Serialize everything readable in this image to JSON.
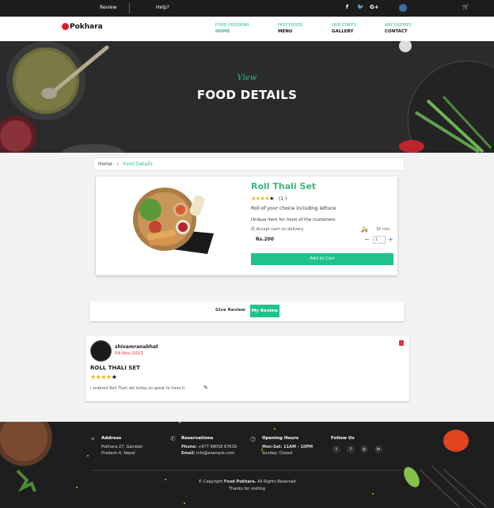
{
  "topbar": {
    "review": "Review",
    "help": "Help?",
    "icons": [
      "facebook-icon",
      "twitter-icon",
      "google-plus-icon",
      "user-icon",
      "cart-icon"
    ],
    "gplus": "G+"
  },
  "brand": {
    "name": "Pokhara"
  },
  "nav": [
    {
      "sub": "FOOD ORDERING",
      "main": "HOME"
    },
    {
      "sub": "FAST FOODS",
      "main": "MENU"
    },
    {
      "sub": "OUR STAFFS",
      "main": "GALLERY"
    },
    {
      "sub": "ANY QUERIES",
      "main": "CONTACT"
    }
  ],
  "hero": {
    "subtitle": "View",
    "title": "FOOD DETAILS"
  },
  "breadcrumb": {
    "home": "Home",
    "sep": "›",
    "current": "Food Details"
  },
  "product": {
    "name": "Roll Thali Set",
    "rating_count": "(1 )",
    "rating": 4,
    "rating_max": 5,
    "description": "Roll of your choice including lettuce",
    "note": "Unique item for most of the customers",
    "payment": "Accept cash on delivery",
    "delivery_time": "30 min.",
    "price": "Rs.200",
    "quantity": "1",
    "add_to_cart": "Add to Cart"
  },
  "tabs": {
    "give_review": "Give Review",
    "my_review": "My Review"
  },
  "review": {
    "user": "shivamranabhat",
    "date": "04-Nov-2022",
    "title": "ROLL THALI SET",
    "rating": 4,
    "text": "I ordered Roll Thali set today so great to have it."
  },
  "footer": {
    "address_h": "Address",
    "address_1": "Pokhara-27, Gandaki",
    "address_2": "Pradesh-4, Nepal",
    "reserv_h": "Reservations",
    "phone_label": "Phone:",
    "phone": "+977 98058 67639",
    "email_label": "Email:",
    "email": "info@example.com",
    "hours_h": "Opening Hours",
    "hours_1": "Mon-Sat: 11AM - 10PM",
    "hours_2": "Sunday: Closed",
    "follow_h": "Follow Us",
    "copyright_pre": "© Copyright",
    "copyright_brand": "Food Pokhara.",
    "copyright_post": "All Rights Reserved",
    "thanks": "Thanks for visiting"
  },
  "colors": {
    "accent": "#1fc28a",
    "brand_red": "#e21b2c",
    "star": "#f0b400"
  }
}
